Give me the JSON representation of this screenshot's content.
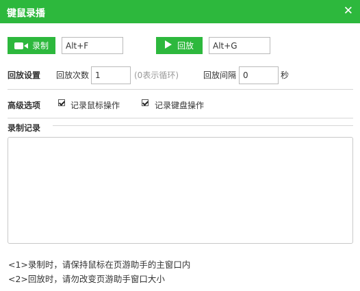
{
  "window": {
    "title": "键鼠录播",
    "close_glyph": "✕"
  },
  "toolbar": {
    "record_label": "录制",
    "record_hotkey": "Alt+F",
    "playback_label": "回放",
    "playback_hotkey": "Alt+G"
  },
  "playback_settings": {
    "section": "回放设置",
    "count_label": "回放次数",
    "count_value": "1",
    "count_hint": "(0表示循环)",
    "interval_label": "回放间隔",
    "interval_value": "0",
    "interval_unit": "秒"
  },
  "advanced": {
    "section": "高级选项",
    "record_mouse": {
      "label": "记录鼠标操作",
      "checked": true
    },
    "record_keyboard": {
      "label": "记录键盘操作",
      "checked": true
    }
  },
  "records": {
    "section": "录制记录",
    "content": ""
  },
  "notes": [
    "<1>录制时，请保持鼠标在页游助手的主窗口内",
    "<2>回放时，请勿改变页游助手窗口大小"
  ],
  "colors": {
    "accent": "#2db83d"
  }
}
